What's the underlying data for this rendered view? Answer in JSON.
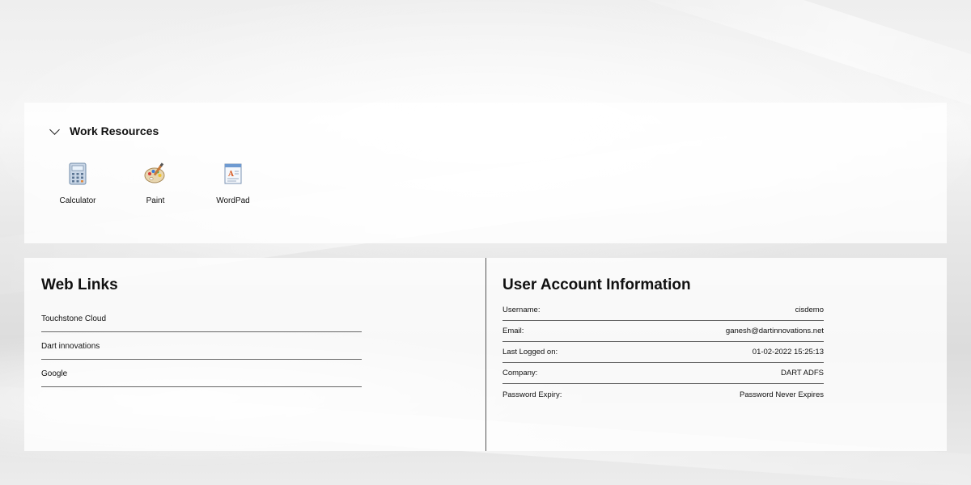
{
  "work_resources": {
    "title": "Work Resources",
    "apps": [
      {
        "label": "Calculator",
        "icon": "calculator-icon"
      },
      {
        "label": "Paint",
        "icon": "paint-palette-icon"
      },
      {
        "label": "WordPad",
        "icon": "wordpad-icon"
      }
    ]
  },
  "web_links": {
    "title": "Web Links",
    "items": [
      {
        "label": "Touchstone Cloud"
      },
      {
        "label": "Dart innovations"
      },
      {
        "label": "Google"
      }
    ]
  },
  "user_account": {
    "title": "User Account Information",
    "rows": [
      {
        "label": "Username:",
        "value": "cisdemo"
      },
      {
        "label": "Email:",
        "value": "ganesh@dartinnovations.net"
      },
      {
        "label": "Last Logged on:",
        "value": "01-02-2022 15:25:13"
      },
      {
        "label": "Company:",
        "value": "DART ADFS"
      },
      {
        "label": "Password Expiry:",
        "value": "Password Never Expires"
      }
    ]
  }
}
